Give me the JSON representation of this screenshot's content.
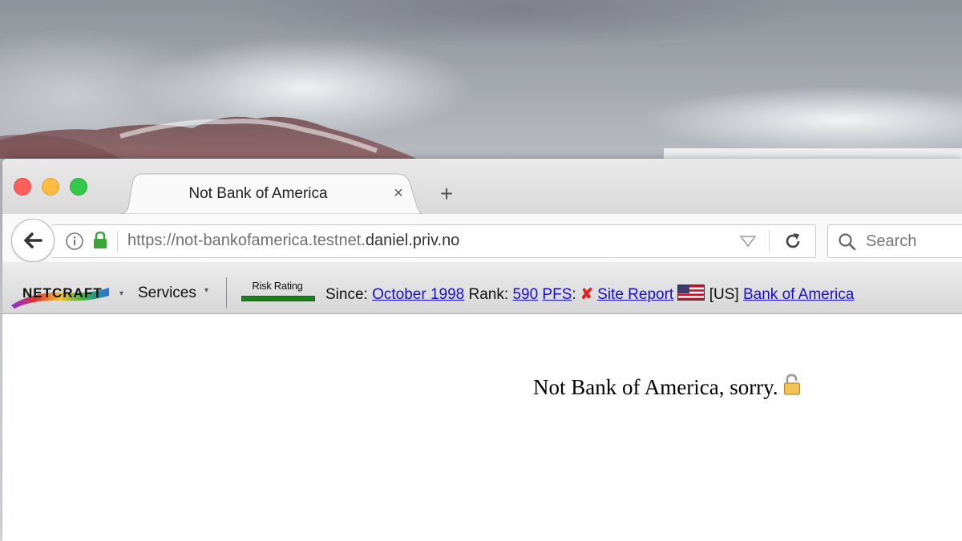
{
  "tab": {
    "title": "Not Bank of America",
    "close": "×",
    "new_tab": "+"
  },
  "address_bar": {
    "url_prefix": "https://not-bankofamerica.testnet.",
    "url_domain": "daniel.priv.no"
  },
  "search": {
    "placeholder": "Search"
  },
  "netcraft": {
    "logo": "NETCRAFT",
    "menu_arrow": "▾",
    "services_label": "Services",
    "risk_label": "Risk Rating",
    "risk_level": 0.2,
    "since_label": "Since:",
    "since_value": "October 1998",
    "rank_label": "Rank:",
    "rank_value": "590",
    "pfs_label": "PFS",
    "pfs_colon": ":",
    "pfs_status": "✘",
    "site_report": "Site Report",
    "country_code": "[US]",
    "org": "Bank of America"
  },
  "page": {
    "message": "Not Bank of America, sorry."
  },
  "colors": {
    "link": "#1a0dd6",
    "risk_green": "#1b7f1b",
    "lock_green": "#3aa53a"
  }
}
